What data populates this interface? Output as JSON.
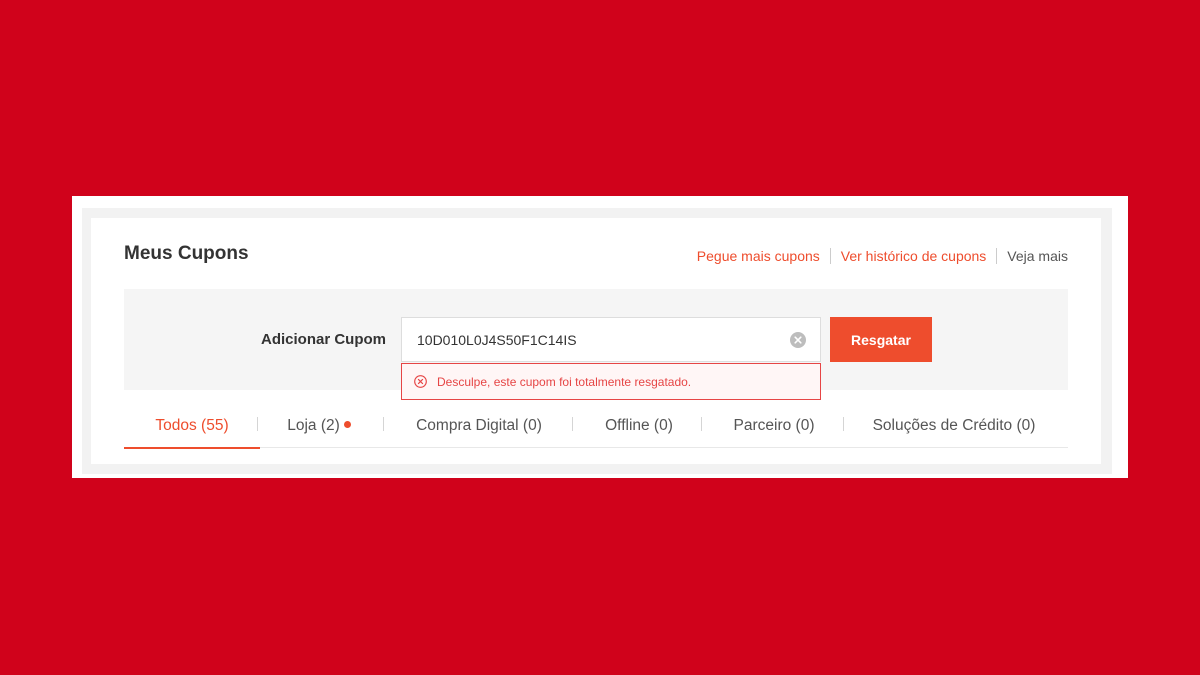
{
  "header": {
    "title": "Meus Cupons",
    "links": [
      {
        "label": "Pegue mais cupons"
      },
      {
        "label": "Ver histórico de cupons"
      },
      {
        "label": "Veja mais"
      }
    ]
  },
  "redeem": {
    "label": "Adicionar Cupom",
    "code_value": "10D010L0J4S50F1C14IS",
    "button_label": "Resgatar",
    "error_message": "Desculpe, este cupom foi totalmente resgatado."
  },
  "tabs": [
    {
      "label": "Todos (55)",
      "active": true
    },
    {
      "label": "Loja (2)",
      "has_dot": true
    },
    {
      "label": "Compra Digital (0)"
    },
    {
      "label": "Offline (0)"
    },
    {
      "label": "Parceiro (0)"
    },
    {
      "label": "Soluções de Crédito (0)"
    }
  ],
  "colors": {
    "background": "#d0021b",
    "accent": "#ee4d2d",
    "error": "#e64545"
  },
  "icons": [
    "clear-input-icon",
    "error-circle-x-icon",
    "notification-dot"
  ]
}
